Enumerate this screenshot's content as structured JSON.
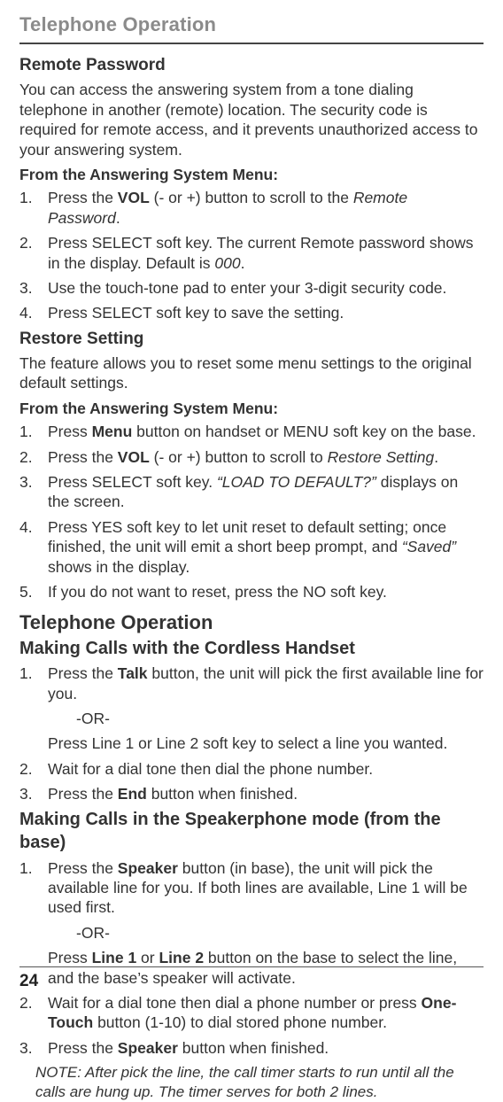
{
  "header": "Telephone Operation",
  "page_number": "24",
  "remote_password": {
    "title": "Remote Password",
    "intro": "You can access the answering system from a tone dialing telephone in another (remote) location. The security code is required for remote access, and it prevents unauthorized access to your answering system.",
    "menu_label": "From the Answering System Menu:",
    "steps": {
      "n1": "1.",
      "s1a": "Press the ",
      "s1b": "VOL",
      "s1c": " (- or +) button to scroll to the ",
      "s1d": "Remote Password",
      "s1e": ".",
      "n2": "2.",
      "s2a": "Press SELECT soft key. The current Remote password shows in the display. Default is ",
      "s2b": "000",
      "s2c": ".",
      "n3": "3.",
      "s3": "Use the touch-tone pad to enter your 3-digit security code.",
      "n4": "4.",
      "s4": "Press SELECT soft key to save the setting."
    }
  },
  "restore_setting": {
    "title": "Restore Setting",
    "intro": "The feature allows you to reset some menu settings to the original default settings.",
    "menu_label": "From the Answering System Menu:",
    "steps": {
      "n1": "1.",
      "s1a": "Press ",
      "s1b": "Menu",
      "s1c": " button on handset or MENU soft key on the base.",
      "n2": "2.",
      "s2a": "Press the ",
      "s2b": "VOL",
      "s2c": " (- or +) button to scroll to ",
      "s2d": "Restore Setting",
      "s2e": ".",
      "n3": "3.",
      "s3a": "Press SELECT soft key. ",
      "s3b": "“LOAD TO DEFAULT?”",
      "s3c": " displays on the screen.",
      "n4": "4.",
      "s4a": "Press YES soft key to let unit reset to default setting; once finished, the unit will emit a short beep prompt, and ",
      "s4b": "“Saved”",
      "s4c": " shows in the display.",
      "n5": "5.",
      "s5": "If you do not want to reset, press the NO soft key."
    }
  },
  "telephone_operation": {
    "title": "Telephone Operation",
    "cordless": {
      "title": "Making Calls with the Cordless Handset",
      "n1": "1.",
      "s1a": "Press the ",
      "s1b": "Talk",
      "s1c": " button, the unit will pick the first available line for you.",
      "or": "-OR-",
      "s1alt": "Press Line 1 or Line 2 soft key to select a line you wanted.",
      "n2": "2.",
      "s2": "Wait for a dial tone then dial the phone number.",
      "n3": "3.",
      "s3a": "Press the ",
      "s3b": "End",
      "s3c": " button when finished."
    },
    "speakerphone": {
      "title": "Making Calls in the Speakerphone mode (from the base)",
      "n1": "1.",
      "s1a": "Press the ",
      "s1b": "Speaker",
      "s1c": " button (in base), the unit will pick the available line for you. If both lines are available, Line 1 will be used first.",
      "or": "-OR-",
      "s1alt_a": "Press ",
      "s1alt_b": "Line 1",
      "s1alt_c": " or ",
      "s1alt_d": "Line 2",
      "s1alt_e": " button on the base to select the line, and the base’s speaker will activate.",
      "n2": "2.",
      "s2a": "Wait for a dial tone then dial a phone number or press ",
      "s2b": "One-Touch",
      "s2c": " button (1-10) to dial stored phone number.",
      "n3": "3.",
      "s3a": "Press the ",
      "s3b": "Speaker",
      "s3c": " button when finished."
    },
    "note": "NOTE: After pick the line, the call timer starts to run until all the calls are hung up. The timer serves for both 2 lines."
  }
}
